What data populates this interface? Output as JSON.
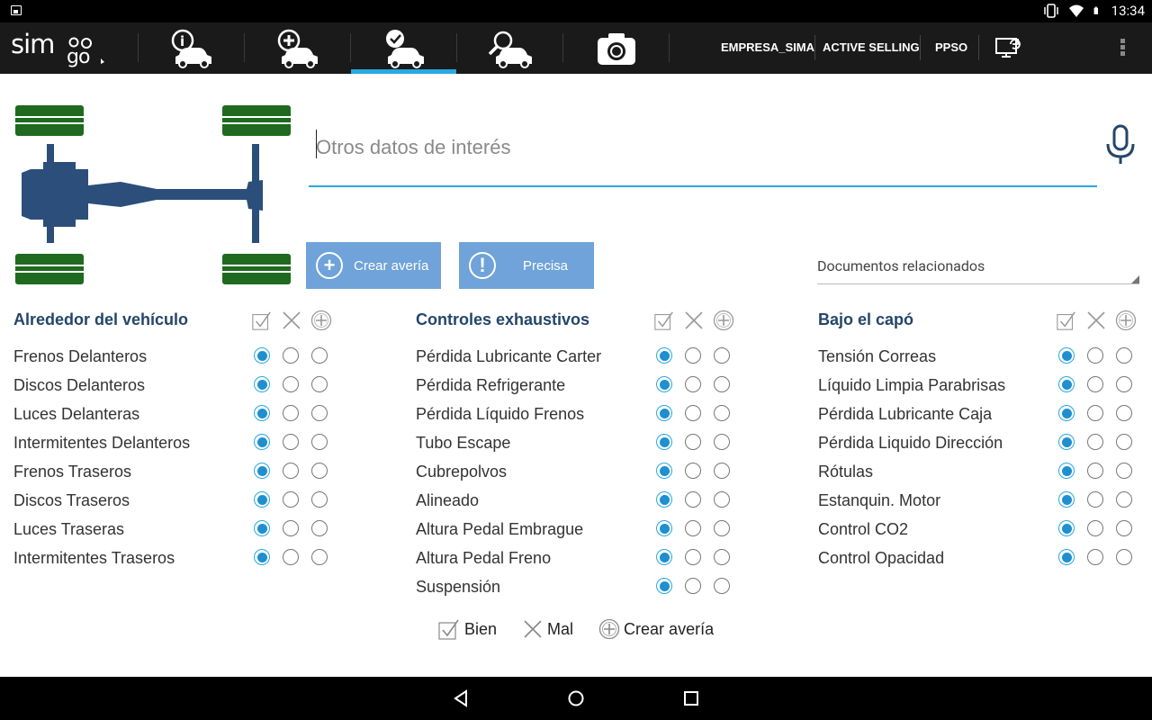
{
  "status": {
    "time": "13:34"
  },
  "appbar": {
    "logo": "simago",
    "links": [
      "EMPRESA_SIMA",
      "ACTIVE SELLING",
      "PPSO"
    ]
  },
  "form": {
    "placeholder": "Otros datos de interés",
    "btn_create": "Crear avería",
    "btn_precisa": "Precisa",
    "docs_label": "Documentos relacionados"
  },
  "columns": [
    {
      "title": "Alrededor del vehículo",
      "items": [
        "Frenos Delanteros",
        "Discos Delanteros",
        "Luces Delanteras",
        "Intermitentes Delanteros",
        "Frenos Traseros",
        "Discos Traseros",
        "Luces Traseras",
        "Intermitentes Traseros"
      ]
    },
    {
      "title": "Controles exhaustivos",
      "items": [
        "Pérdida Lubricante Carter",
        "Pérdida Refrigerante",
        "Pérdida Líquido Frenos",
        "Tubo Escape",
        "Cubrepolvos",
        "Alineado",
        "Altura Pedal Embrague",
        "Altura Pedal Freno",
        "Suspensión"
      ]
    },
    {
      "title": "Bajo el capó",
      "items": [
        "Tensión Correas",
        "Líquido Limpia Parabrisas",
        "Pérdida Lubricante Caja",
        "Pérdida Liquido Dirección",
        "Rótulas",
        "Estanquin. Motor",
        "Control CO2",
        "Control Opacidad"
      ]
    }
  ],
  "legend": {
    "good": "Bien",
    "bad": "Mal",
    "create": "Crear avería"
  },
  "colors": {
    "accent": "#29a9e1",
    "heading": "#23466a",
    "button": "#6fa3d9",
    "chassis": "#2b4f7a",
    "wheel": "#1f6a1f"
  }
}
